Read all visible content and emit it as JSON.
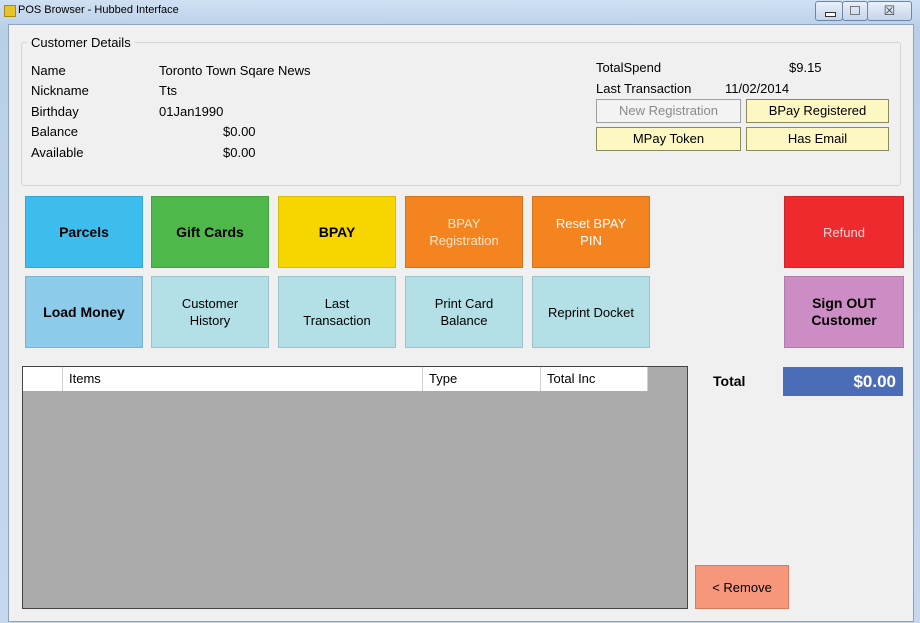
{
  "window": {
    "title": "POS Browser - Hubbed Interface",
    "controls": {
      "minimize": "minimize-icon",
      "maximize": "maximize-icon",
      "close_glyph": "☒"
    }
  },
  "customer": {
    "section_title": "Customer Details",
    "fields": [
      {
        "label": "Name",
        "value": "Toronto Town Sqare News"
      },
      {
        "label": "Nickname",
        "value": "Tts"
      },
      {
        "label": "Birthday",
        "value": "01Jan1990"
      },
      {
        "label": "Balance",
        "value": "$0.00"
      },
      {
        "label": "Available",
        "value": "$0.00"
      }
    ],
    "total_spend_label": "TotalSpend",
    "total_spend_value": "$9.15",
    "last_transaction_label": "Last Transaction",
    "last_transaction_value": "11/02/2014"
  },
  "status_buttons": {
    "new_registration": "New Registration",
    "bpay_registered": "BPay Registered",
    "mpay_token": "MPay Token",
    "has_email": "Has Email"
  },
  "actions": {
    "parcels": "Parcels",
    "gift_cards": "Gift Cards",
    "bpay": "BPAY",
    "bpay_registration": "BPAY\nRegistration",
    "reset_bpay_pin": "Reset BPAY\nPIN",
    "refund": "Refund",
    "load_money": "Load Money",
    "customer_history": "Customer\nHistory",
    "last_transaction": "Last\nTransaction",
    "print_card_balance": "Print Card\nBalance",
    "reprint_docket": "Reprint Docket",
    "sign_out": "Sign OUT\nCustomer"
  },
  "items_grid": {
    "columns": [
      "Items",
      "Type",
      "Total Inc"
    ],
    "rows": []
  },
  "totals": {
    "label": "Total",
    "value": "$0.00"
  },
  "remove_button": "< Remove",
  "colors": {
    "parcels": "#3dbdee",
    "gift_cards": "#4fb84a",
    "bpay": "#f7d600",
    "bpay_registration": "#f4841f",
    "reset_bpay_pin": "#f4841f",
    "refund": "#ee2a2f",
    "load_money": "#8ccbea",
    "secondary": "#b3dfe6",
    "sign_out": "#cc8cc4",
    "total_box": "#4b6db7",
    "remove": "#f6967a"
  }
}
